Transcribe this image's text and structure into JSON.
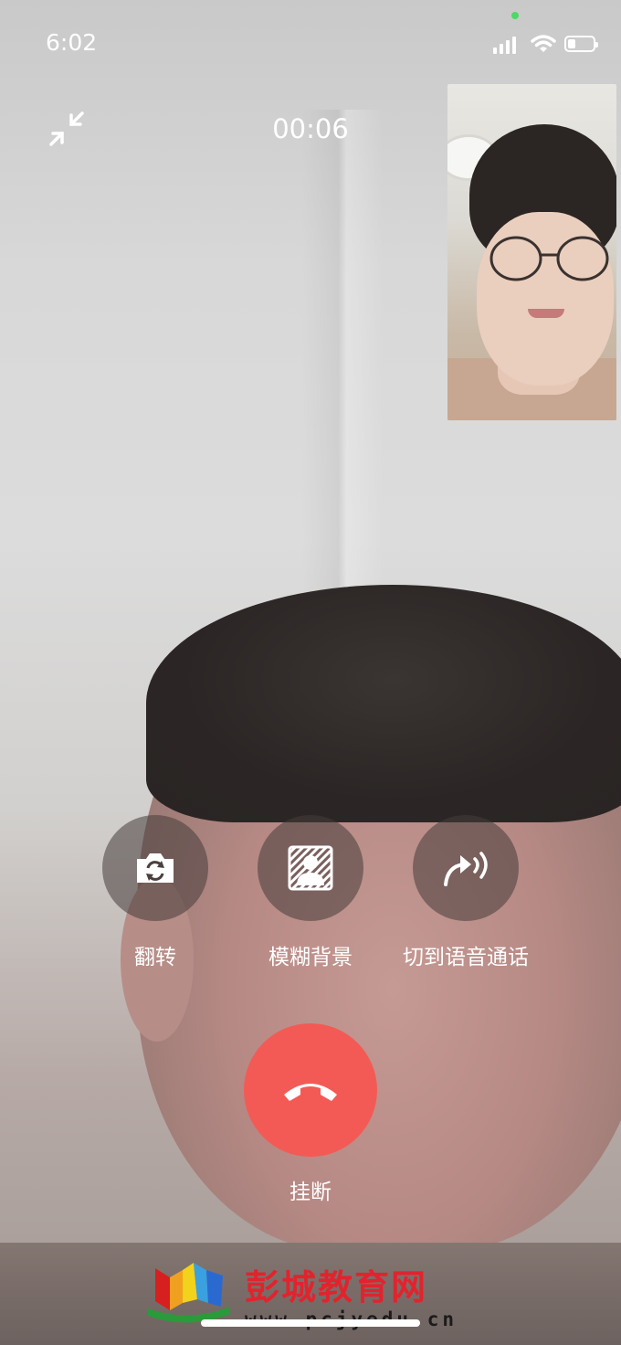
{
  "status_bar": {
    "time": "6:02"
  },
  "call": {
    "timer": "00:06"
  },
  "controls": [
    {
      "label": "翻转",
      "icon": "camera-flip-icon"
    },
    {
      "label": "模糊背景",
      "icon": "blur-background-icon"
    },
    {
      "label": "切到语音通话",
      "icon": "switch-to-voice-icon"
    }
  ],
  "hangup": {
    "label": "挂断",
    "icon": "hangup-phone-icon",
    "color": "#f45a55"
  },
  "watermark": {
    "title": "彭城教育网",
    "url": "www.pcjyedu.cn",
    "title_color": "#e2232d"
  },
  "icons": {
    "minimize": "minimize-arrows-icon",
    "signal": "cellular-signal-icon",
    "wifi": "wifi-icon",
    "battery": "battery-icon"
  }
}
